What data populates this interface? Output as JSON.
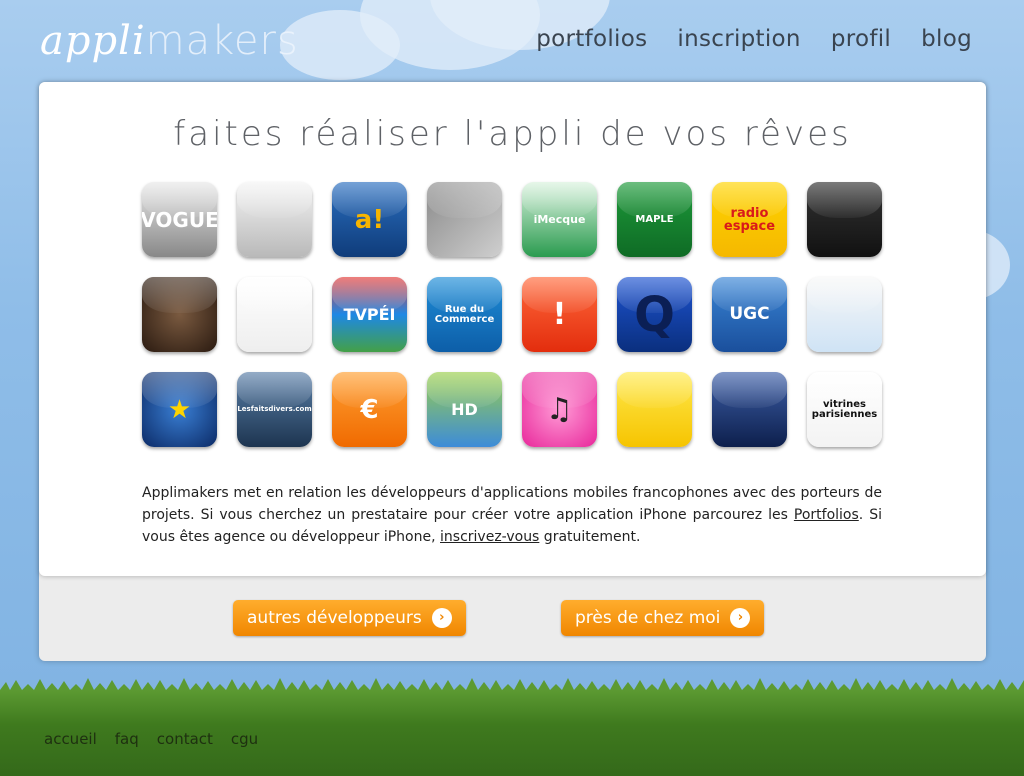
{
  "logo": {
    "part1": "appli",
    "part2": "makers"
  },
  "nav": [
    "portfolios",
    "inscription",
    "profil",
    "blog"
  ],
  "headline": "faites réaliser l'appli de vos rêves",
  "apps": [
    {
      "label": "VOGUE",
      "icon": "vogue-app-icon",
      "bg": "linear-gradient(#e8e8e8,#888)",
      "color": "#fff",
      "size": 20
    },
    {
      "label": "",
      "icon": "globe-app-icon",
      "bg": "linear-gradient(#f4f4f4,#b9b9b9)",
      "color": "#2e7d32",
      "size": 12
    },
    {
      "label": "a!",
      "icon": "arte-app-icon",
      "bg": "linear-gradient(#2b6fc0,#0f3c7a)",
      "color": "#f7b500",
      "size": 26
    },
    {
      "label": "",
      "icon": "photo-grid-app-icon",
      "bg": "linear-gradient(135deg,#8a8a8a,#cfcfcf)",
      "color": "#fff",
      "size": 12
    },
    {
      "label": "iMecque",
      "icon": "imecque-app-icon",
      "bg": "linear-gradient(#d9f2dd,#2a9b4f)",
      "color": "#fff",
      "size": 11
    },
    {
      "label": "MAPLE",
      "icon": "maple-app-icon",
      "bg": "linear-gradient(#1d9a3a,#0f6b25)",
      "color": "#fff",
      "size": 10
    },
    {
      "label": "radio espace",
      "icon": "radio-espace-app-icon",
      "bg": "linear-gradient(#ffd400,#f5b800)",
      "color": "#d91a1a",
      "size": 13
    },
    {
      "label": "",
      "icon": "france-map-app-icon",
      "bg": "linear-gradient(#333,#111)",
      "color": "#fff",
      "size": 12
    },
    {
      "label": "",
      "icon": "portrait-app-icon",
      "bg": "radial-gradient(#7a5a40,#2a1a10)",
      "color": "#fff",
      "size": 12
    },
    {
      "label": "",
      "icon": "little-prince-app-icon",
      "bg": "linear-gradient(#fff,#eee)",
      "color": "#c08",
      "size": 12
    },
    {
      "label": "TVPÉI",
      "icon": "tvpei-app-icon",
      "bg": "linear-gradient(#e53935,#1e88e5 50%,#43a047)",
      "color": "#fff",
      "size": 16
    },
    {
      "label": "Rue du Commerce",
      "icon": "rue-du-commerce-app-icon",
      "bg": "linear-gradient(#1f8ed8,#0d5ea8)",
      "color": "#fff",
      "size": 10
    },
    {
      "label": "!",
      "icon": "alert-app-icon",
      "bg": "linear-gradient(#ff6a3c,#e32d0d)",
      "color": "#fff",
      "size": 30
    },
    {
      "label": "Q",
      "icon": "q-app-icon",
      "bg": "linear-gradient(#1e54d1,#0a2f7e)",
      "color": "#0b1f55",
      "size": 48
    },
    {
      "label": "UGC",
      "icon": "ugc-app-icon",
      "bg": "linear-gradient(#3a86d6,#1a4f9c)",
      "color": "#fff",
      "size": 17
    },
    {
      "label": "",
      "icon": "barcode-app-icon",
      "bg": "linear-gradient(#f7f7f7,#cfe3f5)",
      "color": "#333",
      "size": 12
    },
    {
      "label": "★",
      "icon": "europe-globe-app-icon",
      "bg": "radial-gradient(#3a7fd4,#0b2a66)",
      "color": "#ffd400",
      "size": 26
    },
    {
      "label": "Lesfaitsdivers.com",
      "icon": "faits-divers-app-icon",
      "bg": "linear-gradient(#5a7fa8,#1d3550)",
      "color": "#fff",
      "size": 7
    },
    {
      "label": "€",
      "icon": "fuel-price-app-icon",
      "bg": "linear-gradient(#ffa033,#f06a00)",
      "color": "#fff",
      "size": 26
    },
    {
      "label": "HD",
      "icon": "game-hd-app-icon",
      "bg": "linear-gradient(#9bcf4b,#3d8cd9)",
      "color": "#fff",
      "size": 16
    },
    {
      "label": "♫",
      "icon": "music-bus-app-icon",
      "bg": "radial-gradient(#ff9ad6,#e8279a)",
      "color": "#222",
      "size": 30
    },
    {
      "label": "",
      "icon": "camera-music-app-icon",
      "bg": "linear-gradient(#ffe94d,#f6c400)",
      "color": "#333",
      "size": 12
    },
    {
      "label": "",
      "icon": "mailbox-balloons-app-icon",
      "bg": "linear-gradient(#3d5fa8,#0d1f4c)",
      "color": "#fff",
      "size": 12
    },
    {
      "label": "vitrines parisiennes",
      "icon": "vitrines-parisiennes-app-icon",
      "bg": "linear-gradient(#fff,#f3f3f3)",
      "color": "#111",
      "size": 10
    }
  ],
  "description": {
    "text1": "Applimakers met en relation les développeurs d'applications mobiles francophones avec des porteurs de projets. Si vous cherchez un prestataire pour créer votre application iPhone parcourez les ",
    "link1": "Portfolios",
    "text2": ". Si vous êtes agence ou développeur iPhone, ",
    "link2": "inscrivez-vous",
    "text3": " gratuitement."
  },
  "buttons": {
    "other_devs": "autres développeurs",
    "near_me": "près de chez moi"
  },
  "footer": [
    "accueil",
    "faq",
    "contact",
    "cgu"
  ]
}
